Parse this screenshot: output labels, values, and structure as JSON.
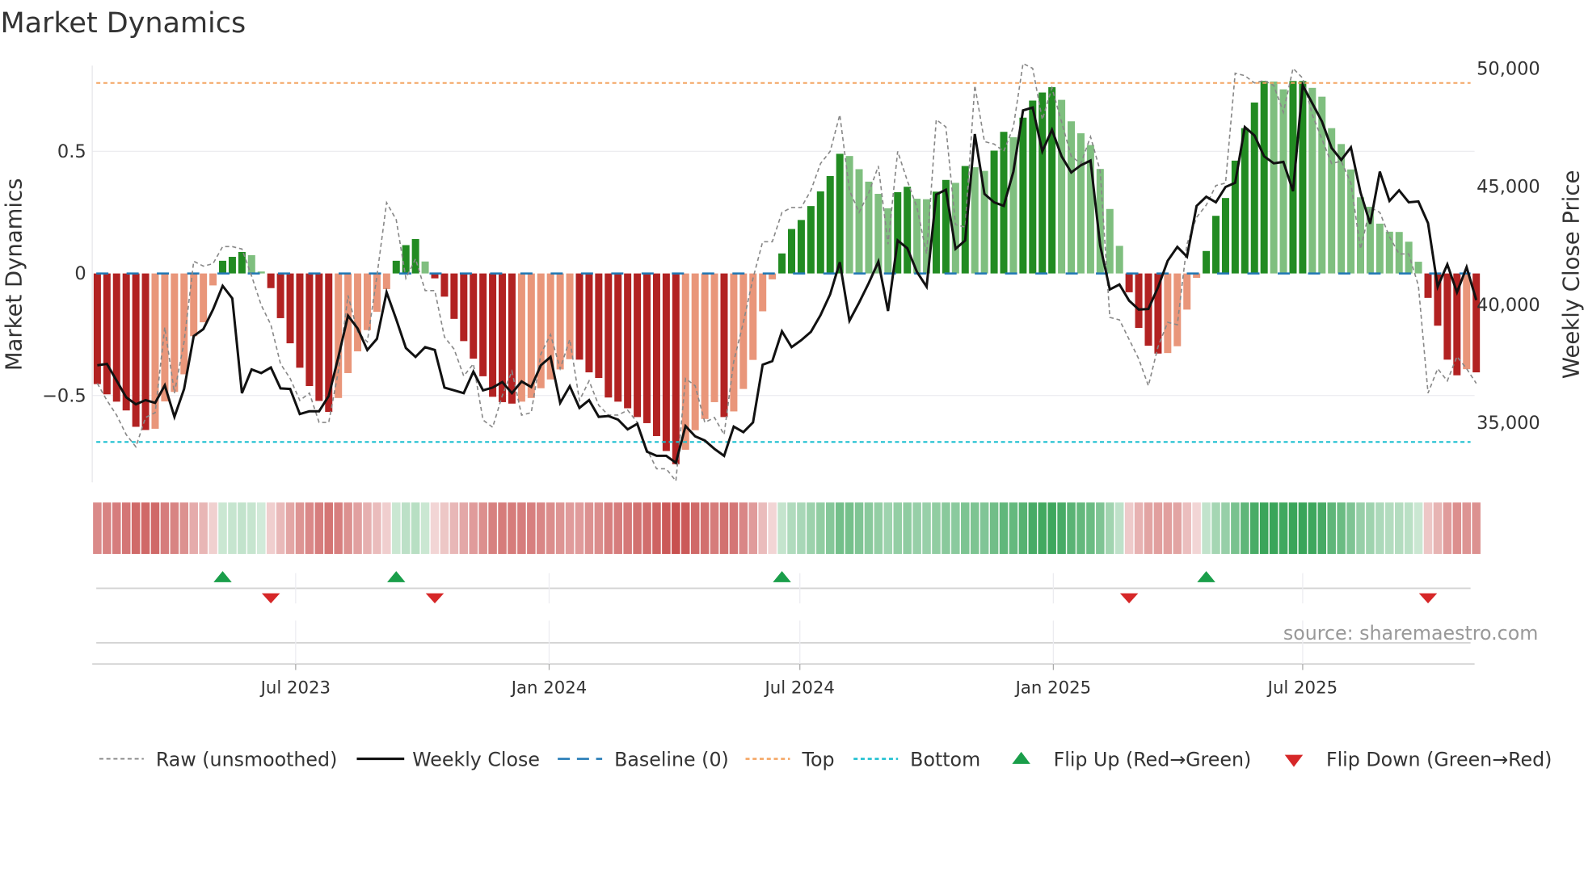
{
  "chart_data": {
    "type": "bar",
    "title": "Market Dynamics",
    "ylabel": "Market Dynamics",
    "y2label": "Weekly Close Price",
    "start_date": "2023-02-07",
    "interval": "weekly",
    "ylim": [
      -0.88,
      0.86
    ],
    "y2lim": [
      32700,
      50700
    ],
    "yticks": [
      {
        "v": 0.5,
        "label": "0.5"
      },
      {
        "v": 0,
        "label": "0"
      },
      {
        "v": -0.5,
        "label": "−0.5"
      }
    ],
    "y2ticks": [
      {
        "v": 50000,
        "label": "50,000"
      },
      {
        "v": 45000,
        "label": "45,000"
      },
      {
        "v": 40000,
        "label": "40,000"
      },
      {
        "v": 35000,
        "label": "35,000"
      }
    ],
    "xticks": [
      {
        "date": "2023-07-01",
        "label": "Jul 2023"
      },
      {
        "date": "2024-01-01",
        "label": "Jan 2024"
      },
      {
        "date": "2024-07-01",
        "label": "Jul 2024"
      },
      {
        "date": "2025-01-01",
        "label": "Jan 2025"
      },
      {
        "date": "2025-07-01",
        "label": "Jul 2025"
      }
    ],
    "top_level": 0.78,
    "bottom_level": -0.69,
    "baseline": 0,
    "momentum": [
      -0.453,
      -0.495,
      -0.525,
      -0.561,
      -0.628,
      -0.641,
      -0.636,
      -0.524,
      -0.485,
      -0.413,
      -0.257,
      -0.2,
      -0.049,
      0.052,
      0.068,
      0.088,
      0.075,
      0.008,
      -0.06,
      -0.183,
      -0.286,
      -0.386,
      -0.461,
      -0.522,
      -0.567,
      -0.51,
      -0.408,
      -0.319,
      -0.232,
      -0.157,
      -0.064,
      0.052,
      0.116,
      0.141,
      0.049,
      -0.02,
      -0.095,
      -0.186,
      -0.277,
      -0.349,
      -0.421,
      -0.505,
      -0.527,
      -0.533,
      -0.525,
      -0.51,
      -0.47,
      -0.434,
      -0.393,
      -0.351,
      -0.353,
      -0.405,
      -0.428,
      -0.508,
      -0.525,
      -0.552,
      -0.588,
      -0.613,
      -0.666,
      -0.727,
      -0.781,
      -0.722,
      -0.642,
      -0.596,
      -0.527,
      -0.588,
      -0.565,
      -0.473,
      -0.354,
      -0.155,
      -0.024,
      0.082,
      0.182,
      0.219,
      0.276,
      0.336,
      0.399,
      0.49,
      0.481,
      0.427,
      0.376,
      0.326,
      0.267,
      0.333,
      0.355,
      0.306,
      0.304,
      0.335,
      0.383,
      0.371,
      0.44,
      0.435,
      0.42,
      0.503,
      0.58,
      0.558,
      0.638,
      0.708,
      0.741,
      0.763,
      0.711,
      0.623,
      0.574,
      0.526,
      0.428,
      0.264,
      0.113,
      -0.077,
      -0.223,
      -0.296,
      -0.328,
      -0.326,
      -0.298,
      -0.148,
      -0.018,
      0.092,
      0.236,
      0.309,
      0.462,
      0.595,
      0.7,
      0.788,
      0.786,
      0.754,
      0.788,
      0.788,
      0.76,
      0.724,
      0.595,
      0.53,
      0.426,
      0.312,
      0.273,
      0.204,
      0.171,
      0.17,
      0.13,
      0.048,
      -0.1,
      -0.214,
      -0.353,
      -0.417,
      -0.392,
      -0.405
    ],
    "raw": [
      -0.45,
      -0.52,
      -0.58,
      -0.66,
      -0.71,
      -0.59,
      -0.57,
      -0.22,
      -0.49,
      -0.28,
      0.05,
      0.03,
      0.04,
      0.11,
      0.11,
      0.1,
      -0.01,
      -0.13,
      -0.21,
      -0.37,
      -0.43,
      -0.52,
      -0.49,
      -0.61,
      -0.61,
      -0.4,
      -0.09,
      -0.24,
      -0.28,
      -0.01,
      0.29,
      0.22,
      -0.02,
      0.06,
      -0.07,
      -0.07,
      -0.26,
      -0.31,
      -0.42,
      -0.37,
      -0.6,
      -0.63,
      -0.5,
      -0.4,
      -0.58,
      -0.57,
      -0.33,
      -0.25,
      -0.39,
      -0.27,
      -0.52,
      -0.44,
      -0.54,
      -0.58,
      -0.58,
      -0.56,
      -0.61,
      -0.72,
      -0.8,
      -0.8,
      -0.85,
      -0.43,
      -0.46,
      -0.61,
      -0.59,
      -0.66,
      -0.36,
      -0.2,
      -0.02,
      0.13,
      0.13,
      0.25,
      0.27,
      0.27,
      0.34,
      0.45,
      0.5,
      0.65,
      0.34,
      0.25,
      0.33,
      0.44,
      0.12,
      0.5,
      0.38,
      0.27,
      0.08,
      0.63,
      0.6,
      0.2,
      0.19,
      0.77,
      0.54,
      0.53,
      0.5,
      0.6,
      0.86,
      0.84,
      0.63,
      0.76,
      0.62,
      0.48,
      0.45,
      0.56,
      0.42,
      -0.18,
      -0.19,
      -0.27,
      -0.35,
      -0.46,
      -0.3,
      -0.2,
      -0.21,
      0.12,
      0.23,
      0.28,
      0.36,
      0.37,
      0.82,
      0.81,
      0.78,
      0.79,
      0.77,
      0.66,
      0.84,
      0.8,
      0.65,
      0.55,
      0.45,
      0.46,
      0.37,
      0.1,
      0.27,
      0.25,
      0.15,
      0.08,
      0.08,
      -0.05,
      -0.49,
      -0.39,
      -0.44,
      -0.34,
      -0.39,
      -0.45
    ],
    "close": [
      37393,
      37452,
      36744,
      36036,
      35741,
      35918,
      35800,
      36544,
      35210,
      36390,
      38632,
      38927,
      39753,
      40756,
      40225,
      36213,
      37216,
      37063,
      37299,
      36414,
      36390,
      35328,
      35446,
      35446,
      36095,
      37747,
      39494,
      38951,
      38042,
      38514,
      40485,
      39340,
      38125,
      37747,
      38160,
      38042,
      36449,
      36331,
      36213,
      37122,
      36331,
      36449,
      36685,
      36213,
      36709,
      36473,
      37393,
      37747,
      35800,
      36508,
      35588,
      35918,
      35210,
      35245,
      35092,
      34679,
      34915,
      33735,
      33558,
      33558,
      33263,
      34820,
      34384,
      34207,
      33853,
      33558,
      34797,
      34561,
      34974,
      37417,
      37570,
      38833,
      38160,
      38455,
      38809,
      39517,
      40402,
      41759,
      39281,
      40048,
      40874,
      41783,
      39694,
      42680,
      42349,
      41346,
      40721,
      44626,
      44827,
      42325,
      42680,
      47187,
      44650,
      44296,
      44143,
      45594,
      48190,
      48308,
      46455,
      47364,
      46243,
      45559,
      45865,
      46066,
      42467,
      40603,
      40815,
      40131,
      39753,
      39777,
      40697,
      41818,
      42408,
      41995,
      44143,
      44532,
      44296,
      44945,
      45122,
      47482,
      47128,
      46243,
      45948,
      46007,
      44768,
      49252,
      48485,
      47718,
      46597,
      46090,
      46621,
      44709,
      43387,
      45594,
      44355,
      44803,
      44296,
      44332,
      43411,
      40721,
      41665,
      40485,
      41547,
      40154
    ],
    "legend": {
      "position": "bottom",
      "items": [
        "Raw (unsmoothed)",
        "Weekly Close",
        "Baseline (0)",
        "Top",
        "Bottom",
        "Flip Up (Red→Green)",
        "Flip Down (Green→Red)"
      ]
    },
    "source": "source: sharemaestro.com",
    "colors": {
      "pos_strong": "#228b22",
      "pos_weak": "#7fbf7f",
      "neg_strong": "#b22222",
      "neg_weak": "#e9967a",
      "raw": "#888888",
      "close": "#111111",
      "baseline": "#1f77b4",
      "top": "#f4a460",
      "bottom": "#17becf",
      "flip_up": "#1a9e4a",
      "flip_down": "#d62728",
      "strip_pos": "#3aa55a",
      "strip_neg": "#c8504f"
    }
  }
}
